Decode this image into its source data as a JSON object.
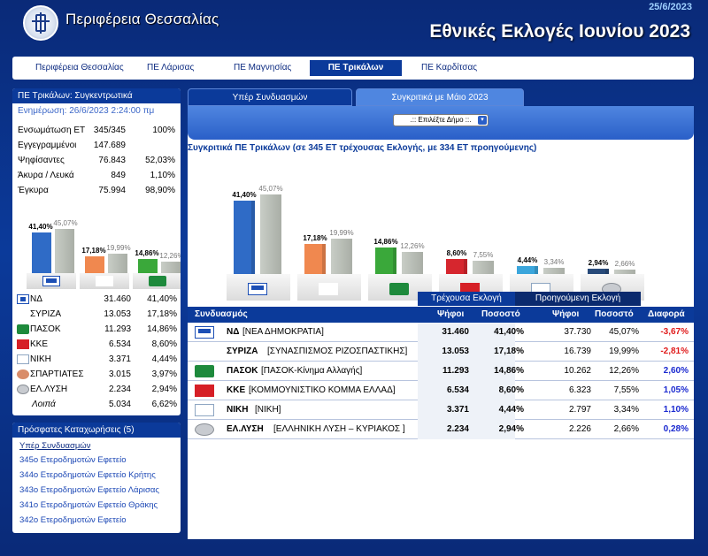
{
  "header": {
    "brand": "Περιφέρεια Θεσσαλίας",
    "date": "25/6/2023",
    "title": "Εθνικές Εκλογές Ιουνίου 2023"
  },
  "nav": [
    {
      "label": "Περιφέρεια Θεσσαλίας",
      "active": false
    },
    {
      "label": "ΠΕ Λάρισας",
      "active": false
    },
    {
      "label": "ΠΕ Μαγνησίας",
      "active": false
    },
    {
      "label": "ΠΕ Τρικάλων",
      "active": true
    },
    {
      "label": "ΠΕ Καρδίτσας",
      "active": false
    }
  ],
  "left": {
    "title": "ΠΕ Τρικάλων: Συγκεντρωτικά",
    "update": "Ενημέρωση: 26/6/2023 2:24:00 πμ",
    "stats": [
      {
        "label": "Ενσωμάτωση ΕΤ",
        "value": "345/345",
        "pct": "100%"
      },
      {
        "label": "Εγγεγραμμένοι",
        "value": "147.689",
        "pct": ""
      },
      {
        "label": "Ψηφίσαντες",
        "value": "76.843",
        "pct": "52,03%"
      },
      {
        "label": "Άκυρα / Λευκά",
        "value": "849",
        "pct": "1,10%"
      },
      {
        "label": "Έγκυρα",
        "value": "75.994",
        "pct": "98,90%"
      }
    ],
    "mini_chart": [
      {
        "party": "ND",
        "cur": "41,40%",
        "prev": "45,07%",
        "color": "#2f6bc6"
      },
      {
        "party": "SYRIZA",
        "cur": "17,18%",
        "prev": "19,99%",
        "color": "#f0884f"
      },
      {
        "party": "PASOK",
        "cur": "14,86%",
        "prev": "12,26%",
        "color": "#3aa83a"
      }
    ],
    "parties": [
      {
        "icon": "nd-logo-icon",
        "name": "ΝΔ",
        "votes": "31.460",
        "pct": "41,40%"
      },
      {
        "icon": "syriza-logo-icon",
        "name": "ΣΥΡΙΖΑ",
        "votes": "13.053",
        "pct": "17,18%"
      },
      {
        "icon": "pasok-logo-icon",
        "name": "ΠΑΣΟΚ",
        "votes": "11.293",
        "pct": "14,86%"
      },
      {
        "icon": "kke-logo-icon",
        "name": "ΚΚΕ",
        "votes": "6.534",
        "pct": "8,60%"
      },
      {
        "icon": "niki-logo-icon",
        "name": "ΝΙΚΗ",
        "votes": "3.371",
        "pct": "4,44%"
      },
      {
        "icon": "spartiates-logo-icon",
        "name": "ΣΠΑΡΤΙΑΤΕΣ",
        "votes": "3.015",
        "pct": "3,97%"
      },
      {
        "icon": "elysi-logo-icon",
        "name": "ΕΛ.ΛΥΣΗ",
        "votes": "2.234",
        "pct": "2,94%"
      },
      {
        "icon": "",
        "name": "Λοιπά",
        "votes": "5.034",
        "pct": "6,62%"
      }
    ]
  },
  "recent": {
    "title": "Πρόσφατες Καταχωρήσεις (5)",
    "subtitle": "Υπέρ Συνδυασμών",
    "items": [
      "345ο Ετεροδημοτών Εφετείο",
      "344ο Ετεροδημοτών Εφετείο Κρήτης",
      "343ο Ετεροδημοτών Εφετείο Λάρισας",
      "341ο Ετεροδημοτών Εφετείο Θράκης",
      "342ο Ετεροδημοτών Εφετείο"
    ]
  },
  "tabs": [
    {
      "label": "Υπέρ Συνδυασμών",
      "active": false
    },
    {
      "label": "Συγκριτικά με Μάιο 2023",
      "active": true
    }
  ],
  "selector": {
    "value": ".:: Επιλέξτε Δήμο ::."
  },
  "compare_title": "Συγκριτικά ΠΕ Τρικάλων (σε 345 ΕΤ τρέχουσας Εκλογής, με 334 ΕΤ προηγούμενης)",
  "chart_data": {
    "type": "bar",
    "categories": [
      "ΝΔ",
      "ΣΥΡΙΖΑ",
      "ΠΑΣΟΚ",
      "ΚΚΕ",
      "ΝΙΚΗ",
      "ΕΛ.ΛΥΣΗ"
    ],
    "series": [
      {
        "values": [
          41.4,
          17.18,
          14.86,
          8.6,
          4.44,
          2.94
        ],
        "labels": [
          "41,40%",
          "17,18%",
          "14,86%",
          "8,60%",
          "4,44%",
          "2,94%"
        ]
      },
      {
        "values": [
          45.07,
          19.99,
          12.26,
          7.55,
          3.34,
          2.66
        ],
        "labels": [
          "45,07%",
          "19,99%",
          "12,26%",
          "7,55%",
          "3,34%",
          "2,66%"
        ]
      }
    ],
    "colors": [
      "#2f6bc6",
      "#f0884f",
      "#3aa83a",
      "#d6262e",
      "#3ba6dc",
      "#284a7a"
    ],
    "prev_color": "#b8bdb5",
    "ylim": [
      0,
      50
    ]
  },
  "results": {
    "current_label": "Τρέχουσα Εκλογή",
    "previous_label": "Προηγούμενη Εκλογή",
    "headers": {
      "party": "Συνδυασμός",
      "votes": "Ψήφοι",
      "pct": "Ποσοστό",
      "pvotes": "Ψήφοι",
      "ppct": "Ποσοστό",
      "diff": "Διαφορά"
    },
    "rows": [
      {
        "icon": "nd-logo-icon",
        "abbr": "ΝΔ",
        "full": "[ΝΕΑ ΔΗΜΟΚΡΑΤΙΑ]",
        "votes": "31.460",
        "pct": "41,40%",
        "pvotes": "37.730",
        "ppct": "45,07%",
        "diff": "-3,67%",
        "sign": "neg"
      },
      {
        "icon": "syriza-logo-icon",
        "abbr": "ΣΥΡΙΖΑ",
        "full": "[ΣΥΝΑΣΠΙΣΜΟΣ ΡΙΖΟΣΠΑΣΤΙΚΗΣ]",
        "votes": "13.053",
        "pct": "17,18%",
        "pvotes": "16.739",
        "ppct": "19,99%",
        "diff": "-2,81%",
        "sign": "neg"
      },
      {
        "icon": "pasok-logo-icon",
        "abbr": "ΠΑΣΟΚ",
        "full": "[ΠΑΣΟΚ-Κίνημα Αλλαγής]",
        "votes": "11.293",
        "pct": "14,86%",
        "pvotes": "10.262",
        "ppct": "12,26%",
        "diff": "2,60%",
        "sign": "pos"
      },
      {
        "icon": "kke-logo-icon",
        "abbr": "ΚΚΕ",
        "full": "[ΚΟΜΜΟΥΝΙΣΤΙΚΟ ΚΟΜΜΑ ΕΛΛΑΔ]",
        "votes": "6.534",
        "pct": "8,60%",
        "pvotes": "6.323",
        "ppct": "7,55%",
        "diff": "1,05%",
        "sign": "pos"
      },
      {
        "icon": "niki-logo-icon",
        "abbr": "ΝΙΚΗ",
        "full": "[ΝΙΚΗ]",
        "votes": "3.371",
        "pct": "4,44%",
        "pvotes": "2.797",
        "ppct": "3,34%",
        "diff": "1,10%",
        "sign": "pos"
      },
      {
        "icon": "elysi-logo-icon",
        "abbr": "ΕΛ.ΛΥΣΗ",
        "full": "[ΕΛΛΗΝΙΚΗ ΛΥΣΗ – ΚΥΡΙΑΚΟΣ ]",
        "votes": "2.234",
        "pct": "2,94%",
        "pvotes": "2.226",
        "ppct": "2,66%",
        "diff": "0,28%",
        "sign": "pos"
      }
    ]
  }
}
